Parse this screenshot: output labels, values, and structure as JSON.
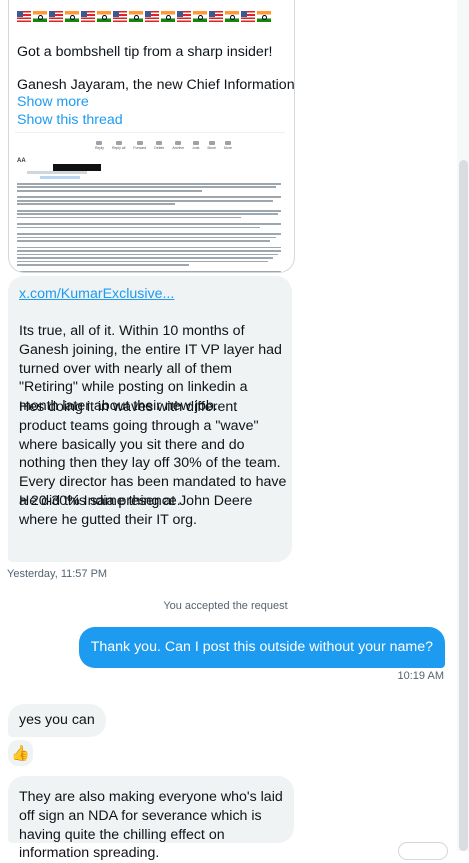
{
  "tweet": {
    "headline": "Got a bombshell tip from a sharp insider!",
    "snippet": "Ganesh Jayaram, the new Chief Information ...",
    "show_more": "Show more",
    "show_thread": "Show this thread",
    "flags": [
      "us",
      "in",
      "us",
      "in",
      "us",
      "in",
      "us",
      "in",
      "us",
      "in",
      "us",
      "in",
      "us",
      "in",
      "us",
      "in"
    ]
  },
  "email_image": {
    "sender_label": "AA",
    "toolbar": [
      "Reply",
      "Reply all",
      "Forward",
      "Delete",
      "Archive",
      "Junk",
      "Move",
      "More"
    ]
  },
  "dm": {
    "link": "x.com/KumarExclusive...",
    "para1": "Its true, all of it. Within 10 months of Ganesh joining, the entire IT VP layer had turned over with nearly all of them \"Retiring\" while posting on linkedin a month later about their new job.",
    "para2": "Hes doing it in waves with different product teams going through a \"wave\" where basically you sit there and do nothing then they lay off 30% of the team. Every director has been mandated to  have a 20-30% India presence.",
    "para3": "He did this same thing at John Deere where he gutted their IT org.",
    "timestamp1": "Yesterday, 11:57 PM",
    "system_message": "You accepted the request",
    "outgoing": "Thank you. Can I post this outside without your name?",
    "timestamp2": "10:19 AM",
    "reply_yes": "yes you can",
    "reaction": "👍",
    "nda_message": "They are also making everyone who's laid off sign an NDA for severance which is having quite the chilling effect on information spreading."
  },
  "colors": {
    "accent": "#1d9bf0",
    "bubble_in": "#eff3f4",
    "muted_text": "#536471"
  }
}
